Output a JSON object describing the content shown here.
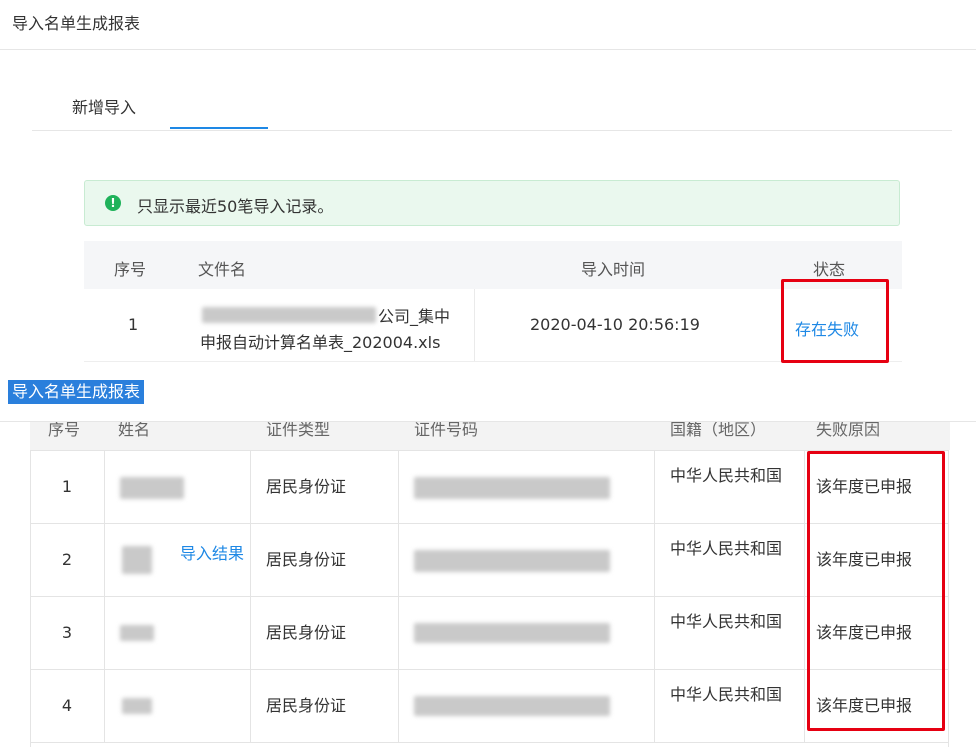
{
  "page": {
    "title": "导入名单生成报表"
  },
  "tabs": [
    {
      "label": "新增导入",
      "active": false
    },
    {
      "label": "导入结果",
      "active": true
    }
  ],
  "alert": {
    "icon": "exclamation-circle-icon",
    "text": "只显示最近50笔导入记录。",
    "color": "#1fb25a"
  },
  "import_table": {
    "headers": [
      "序号",
      "文件名",
      "导入时间",
      "状态"
    ],
    "rows": [
      {
        "index": "1",
        "filename_line1": "公司_集中",
        "filename_line2": "申报自动计算名单表_202004.xls",
        "time": "2020-04-10 20:56:19",
        "status": "存在失败"
      }
    ]
  },
  "overlay_label": "导入名单生成报表",
  "detail_table": {
    "headers": [
      "序号",
      "姓名",
      "证件类型",
      "证件号码",
      "国籍（地区）",
      "失败原因"
    ],
    "rows": [
      {
        "index": "1",
        "doc_type": "居民身份证",
        "nationality": "中华人民共和国",
        "reason": "该年度已申报"
      },
      {
        "index": "2",
        "doc_type": "居民身份证",
        "nationality": "中华人民共和国",
        "reason": "该年度已申报"
      },
      {
        "index": "3",
        "doc_type": "居民身份证",
        "nationality": "中华人民共和国",
        "reason": "该年度已申报"
      },
      {
        "index": "4",
        "doc_type": "居民身份证",
        "nationality": "中华人民共和国",
        "reason": "该年度已申报"
      }
    ]
  },
  "colors": {
    "accent": "#1e88e5",
    "highlight_box": "#e60012",
    "label_bg": "#2a7fdc"
  }
}
